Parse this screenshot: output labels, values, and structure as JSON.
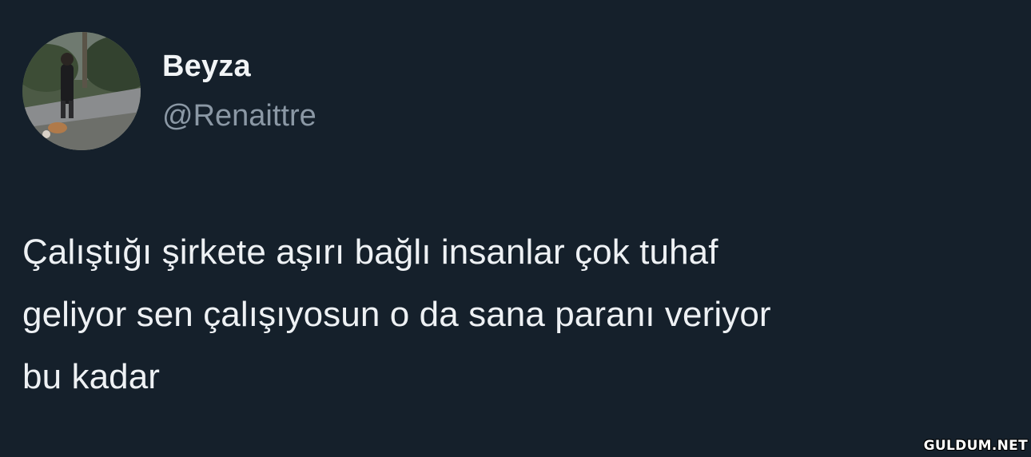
{
  "tweet": {
    "display_name": "Beyza",
    "handle": "@Renaittre",
    "avatar": "profile-photo",
    "text": "Çalıştığı şirkete aşırı bağlı insanlar çok tuhaf\ngeliyor sen çalışıyosun o da sana paranı veriyor\nbu kadar"
  },
  "watermark": "GULDUM.NET",
  "colors": {
    "background": "#15202b",
    "name": "#f1f4f6",
    "handle": "#8b98a5",
    "text": "#eef1f4"
  }
}
